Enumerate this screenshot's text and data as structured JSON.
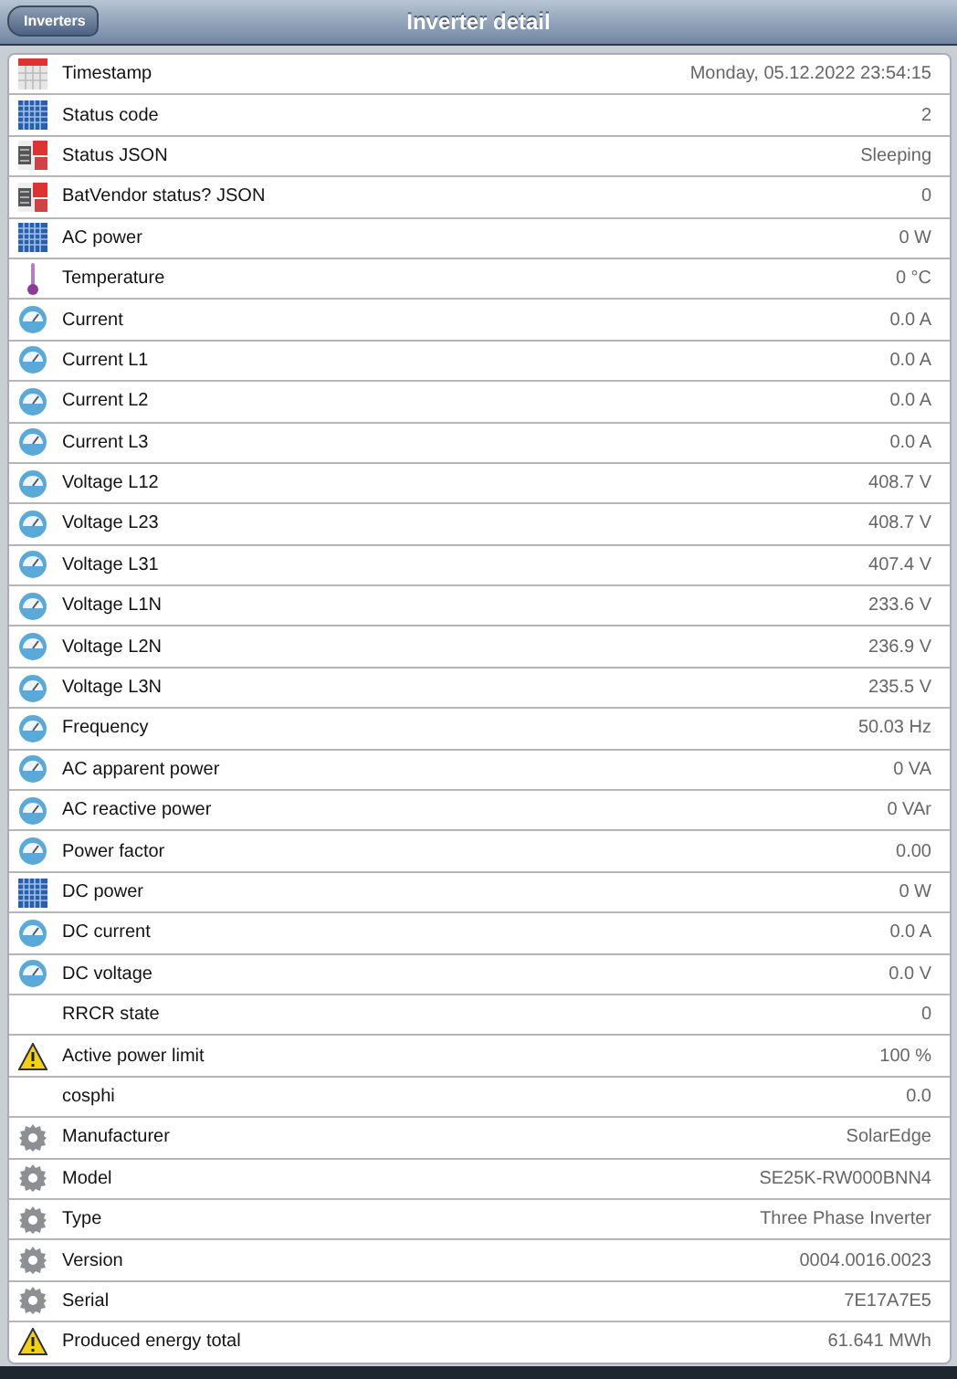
{
  "header": {
    "back_button": "Inverters",
    "title": "Inverter detail"
  },
  "rows": [
    {
      "kind": "calendar",
      "label": "Timestamp",
      "value": "Monday, 05.12.2022 23:54:15"
    },
    {
      "kind": "grid",
      "label": "Status code",
      "value": "2"
    },
    {
      "kind": "status",
      "label": "Status JSON",
      "value": "Sleeping"
    },
    {
      "kind": "status",
      "label": "BatVendor status? JSON",
      "value": "0"
    },
    {
      "kind": "grid",
      "label": "AC power",
      "value": "0 W"
    },
    {
      "kind": "thermometer",
      "label": "Temperature",
      "value": "0 °C"
    },
    {
      "kind": "gauge",
      "label": "Current",
      "value": "0.0 A"
    },
    {
      "kind": "gauge",
      "label": "Current L1",
      "value": "0.0 A"
    },
    {
      "kind": "gauge",
      "label": "Current L2",
      "value": "0.0 A"
    },
    {
      "kind": "gauge",
      "label": "Current L3",
      "value": "0.0 A"
    },
    {
      "kind": "gauge",
      "label": "Voltage L12",
      "value": "408.7 V"
    },
    {
      "kind": "gauge",
      "label": "Voltage L23",
      "value": "408.7 V"
    },
    {
      "kind": "gauge",
      "label": "Voltage L31",
      "value": "407.4 V"
    },
    {
      "kind": "gauge",
      "label": "Voltage L1N",
      "value": "233.6 V"
    },
    {
      "kind": "gauge",
      "label": "Voltage L2N",
      "value": "236.9 V"
    },
    {
      "kind": "gauge",
      "label": "Voltage L3N",
      "value": "235.5 V"
    },
    {
      "kind": "gauge",
      "label": "Frequency",
      "value": "50.03 Hz"
    },
    {
      "kind": "gauge",
      "label": "AC apparent power",
      "value": "0 VA"
    },
    {
      "kind": "gauge",
      "label": "AC reactive power",
      "value": "0 VAr"
    },
    {
      "kind": "gauge",
      "label": "Power factor",
      "value": "0.00"
    },
    {
      "kind": "grid",
      "label": "DC power",
      "value": "0 W"
    },
    {
      "kind": "gauge",
      "label": "DC current",
      "value": "0.0 A"
    },
    {
      "kind": "gauge",
      "label": "DC voltage",
      "value": "0.0 V"
    },
    {
      "kind": "plain",
      "label": "RRCR state",
      "value": "0"
    },
    {
      "kind": "warning",
      "label": "Active power limit",
      "value": "100 %"
    },
    {
      "kind": "plain",
      "label": "cosphi",
      "value": "0.0"
    },
    {
      "kind": "gear",
      "label": "Manufacturer",
      "value": "SolarEdge"
    },
    {
      "kind": "gear",
      "label": "Model",
      "value": "SE25K-RW000BNN4"
    },
    {
      "kind": "gear",
      "label": "Type",
      "value": "Three Phase Inverter"
    },
    {
      "kind": "gear",
      "label": "Version",
      "value": "0004.0016.0023"
    },
    {
      "kind": "gear",
      "label": "Serial",
      "value": "7E17A7E5"
    },
    {
      "kind": "warning",
      "label": "Produced energy total",
      "value": "61.641 MWh"
    }
  ]
}
